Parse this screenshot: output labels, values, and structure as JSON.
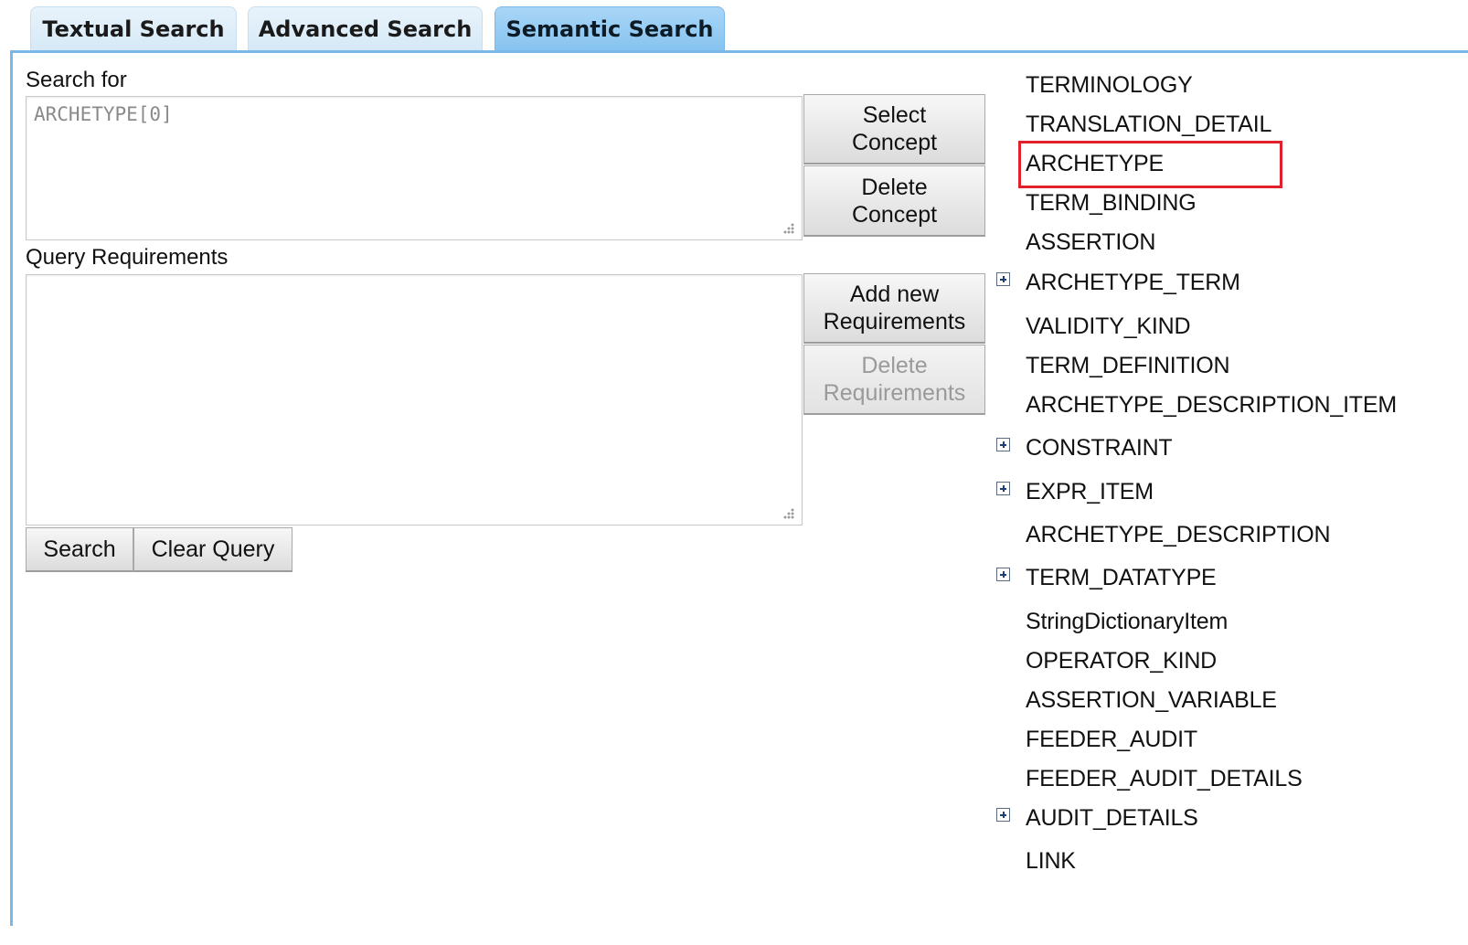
{
  "tabs": [
    {
      "label": "Textual Search",
      "active": false
    },
    {
      "label": "Advanced Search",
      "active": false
    },
    {
      "label": "Semantic Search",
      "active": true
    }
  ],
  "search_for": {
    "label": "Search for",
    "value": "ARCHETYPE[0]"
  },
  "concept_buttons": {
    "select": "Select\nConcept",
    "delete": "Delete\nConcept"
  },
  "query_requirements": {
    "label": "Query Requirements",
    "value": ""
  },
  "requirement_buttons": {
    "add": "Add new\nRequirements",
    "delete": "Delete\nRequirements",
    "delete_enabled": false
  },
  "actions": {
    "search": "Search",
    "clear": "Clear Query"
  },
  "tree": {
    "items": [
      {
        "label": "TERMINOLOGY",
        "expandable": false
      },
      {
        "label": "TRANSLATION_DETAIL",
        "expandable": false
      },
      {
        "label": "ARCHETYPE",
        "expandable": false,
        "highlighted": true
      },
      {
        "label": "TERM_BINDING",
        "expandable": false
      },
      {
        "label": "ASSERTION",
        "expandable": false
      },
      {
        "label": "ARCHETYPE_TERM",
        "expandable": true
      },
      {
        "label": "VALIDITY_KIND",
        "expandable": false
      },
      {
        "label": "TERM_DEFINITION",
        "expandable": false
      },
      {
        "label": "ARCHETYPE_DESCRIPTION_ITEM",
        "expandable": false
      },
      {
        "label": "CONSTRAINT",
        "expandable": true
      },
      {
        "label": "EXPR_ITEM",
        "expandable": true
      },
      {
        "label": "ARCHETYPE_DESCRIPTION",
        "expandable": false
      },
      {
        "label": "TERM_DATATYPE",
        "expandable": true
      },
      {
        "label": "StringDictionaryItem",
        "expandable": false
      },
      {
        "label": "OPERATOR_KIND",
        "expandable": false
      },
      {
        "label": "ASSERTION_VARIABLE",
        "expandable": false
      },
      {
        "label": "FEEDER_AUDIT",
        "expandable": false
      },
      {
        "label": "FEEDER_AUDIT_DETAILS",
        "expandable": false
      },
      {
        "label": "AUDIT_DETAILS",
        "expandable": true
      },
      {
        "label": "LINK",
        "expandable": false
      }
    ]
  },
  "colors": {
    "tab_active": "#86c3f0",
    "tab_inactive": "#d6e9f7",
    "panel_border": "#7ab8e8",
    "highlight": "#e0202a"
  }
}
